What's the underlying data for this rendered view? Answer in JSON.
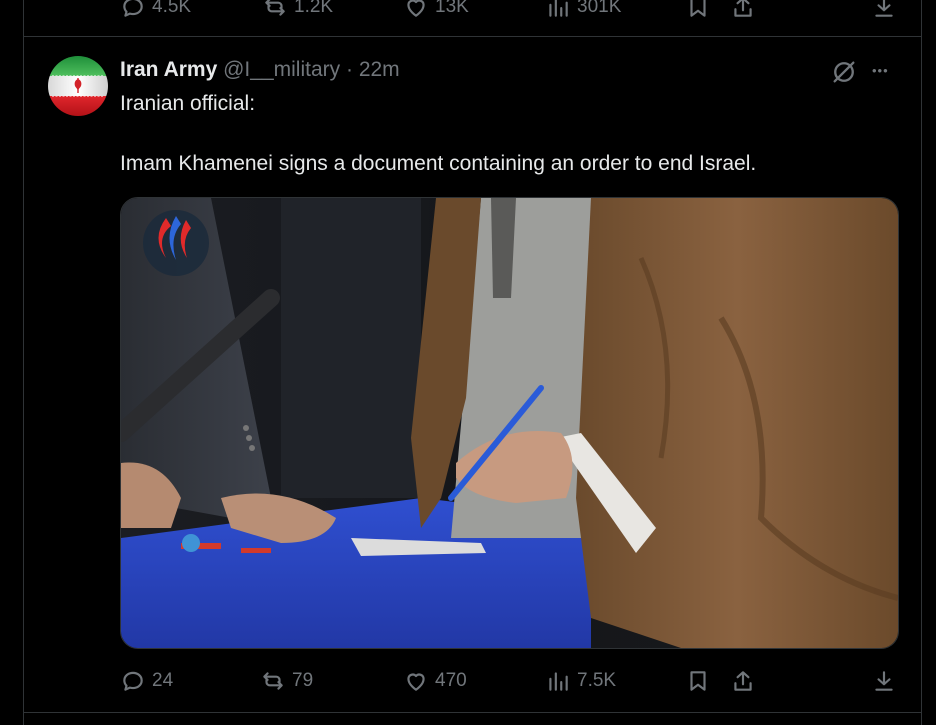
{
  "prev_tweet": {
    "replies": "4.5K",
    "reposts": "1.2K",
    "likes": "13K",
    "views": "301K"
  },
  "tweet": {
    "author_name": "Iran Army",
    "handle": "@I__military",
    "separator": "·",
    "time": "22m",
    "text_line1": "Iranian official:",
    "text_line2": "Imam Khamenei signs a document containing an order to end Israel.",
    "replies": "24",
    "reposts": "79",
    "likes": "470",
    "views": "7.5K",
    "more_label": "•••"
  },
  "icons": {
    "reply": "reply-icon",
    "repost": "repost-icon",
    "like": "heart-icon",
    "views": "bar-chart-icon",
    "bookmark": "bookmark-icon",
    "share": "share-icon",
    "download": "download-icon",
    "grok": "grok-icon",
    "more": "more-icon"
  },
  "colors": {
    "background": "#000000",
    "text": "#e7e9ea",
    "muted": "#71767b",
    "border": "#2f3336"
  }
}
